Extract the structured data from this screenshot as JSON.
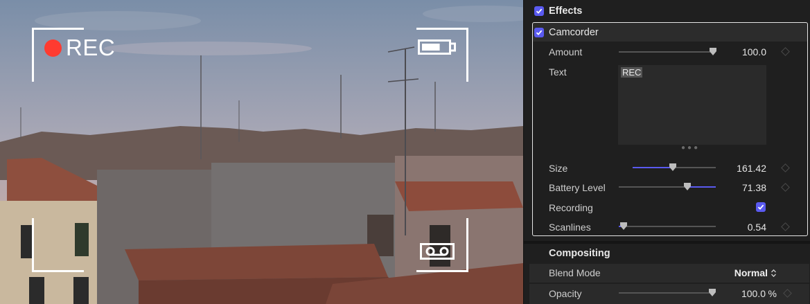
{
  "viewer": {
    "rec_label": "REC",
    "colors": {
      "rec_dot": "#ff3b30",
      "overlay": "#ffffff"
    },
    "icons": [
      "record-dot-icon",
      "battery-icon",
      "tape-cassette-icon"
    ]
  },
  "inspector": {
    "effects": {
      "label": "Effects",
      "checked": true
    },
    "camcorder": {
      "label": "Camcorder",
      "checked": true,
      "params": {
        "amount": {
          "label": "Amount",
          "value": "100.0",
          "fraction": 1.0
        },
        "text": {
          "label": "Text",
          "value": "REC"
        },
        "size": {
          "label": "Size",
          "value": "161.42",
          "fraction": 0.48
        },
        "battery_level": {
          "label": "Battery Level",
          "value": "71.38",
          "fraction": 0.71
        },
        "recording": {
          "label": "Recording",
          "checked": true
        },
        "scanlines": {
          "label": "Scanlines",
          "value": "0.54",
          "fraction": 0.05
        }
      }
    },
    "compositing": {
      "label": "Compositing",
      "blend_mode": {
        "label": "Blend Mode",
        "value": "Normal"
      },
      "opacity": {
        "label": "Opacity",
        "value": "100.0",
        "unit": "%"
      }
    },
    "accent": "#5a5af0"
  }
}
